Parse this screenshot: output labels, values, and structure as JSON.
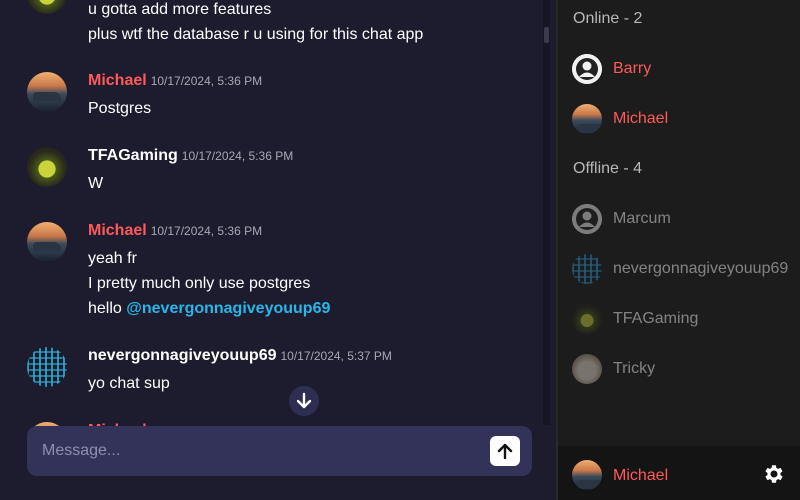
{
  "colors": {
    "accent_red": "#ff5a5a",
    "mention": "#29b6e8",
    "bg": "#1c1c2e",
    "composer": "#33335a"
  },
  "messages": [
    {
      "lines": [
        "u gotta add more features",
        "plus wtf the database r u using for this chat app"
      ]
    },
    {
      "author": "Michael",
      "author_color": "#ff5a5a",
      "time": "10/17/2024, 5:36 PM",
      "lines": [
        "Postgres"
      ]
    },
    {
      "author": "TFAGaming",
      "author_color": "#ffffff",
      "time": "10/17/2024, 5:36 PM",
      "lines": [
        "W"
      ]
    },
    {
      "author": "Michael",
      "author_color": "#ff5a5a",
      "time": "10/17/2024, 5:36 PM",
      "lines": [
        "yeah fr",
        "I pretty much only use postgres",
        "hello"
      ],
      "mention": "@nevergonnagiveyouup69"
    },
    {
      "author": "nevergonnagiveyouup69",
      "author_color": "#ffffff",
      "time": "10/17/2024, 5:37 PM",
      "lines": [
        "yo chat sup"
      ]
    },
    {
      "author": "Michael"
    }
  ],
  "composer": {
    "placeholder": "Message...",
    "value": ""
  },
  "sidebar": {
    "online_title": "Online - 2",
    "online": [
      {
        "name": "Barry"
      },
      {
        "name": "Michael"
      }
    ],
    "offline_title": "Offline - 4",
    "offline": [
      {
        "name": "Marcum"
      },
      {
        "name": "nevergonnagiveyouup69"
      },
      {
        "name": "TFAGaming"
      },
      {
        "name": "Tricky"
      }
    ]
  },
  "current_user": {
    "name": "Michael"
  },
  "icons": {
    "jump": "arrow-down-icon",
    "send": "arrow-up-icon",
    "settings": "gear-icon"
  }
}
